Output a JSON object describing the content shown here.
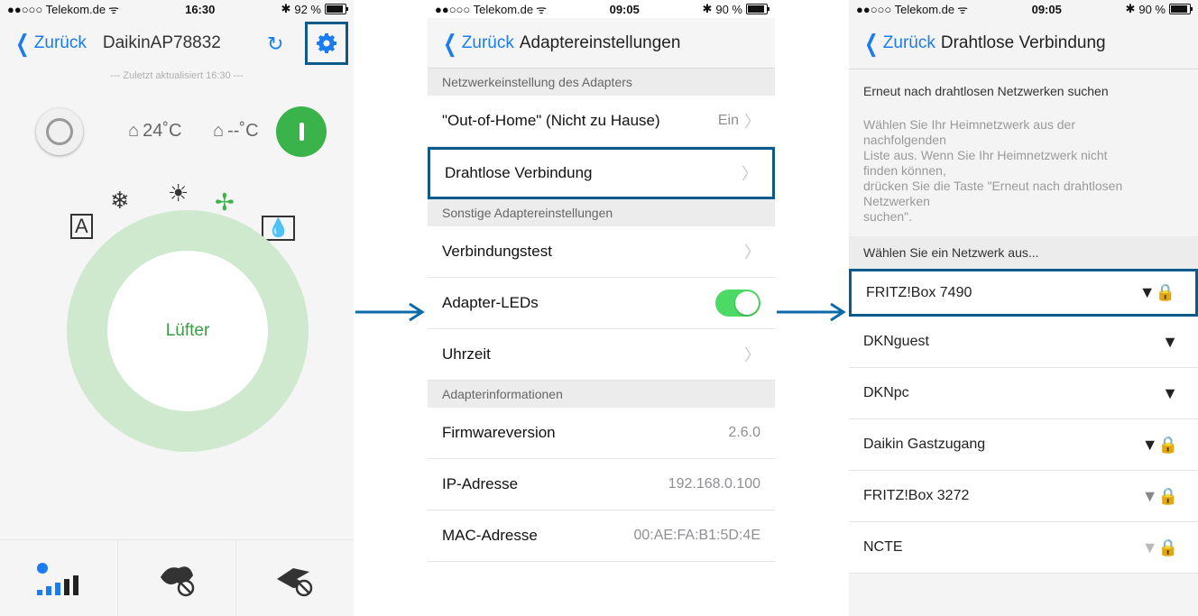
{
  "phone1": {
    "status": {
      "carrier": "●●○○○ Telekom.de",
      "time": "16:30",
      "battery": "92 %"
    },
    "nav": {
      "back": "Zurück",
      "title": "DaikinAP78832"
    },
    "updated": "--- Zuletzt aktualisiert 16:30 ---",
    "temp_indoor": "24˚C",
    "temp_outdoor": "--˚C",
    "mode_label": "Lüfter"
  },
  "phone2": {
    "status": {
      "carrier": "●●○○○ Telekom.de",
      "time": "09:05",
      "battery": "90 %"
    },
    "nav": {
      "back": "Zurück",
      "title": "Adaptereinstellungen"
    },
    "section1": "Netzwerkeinstellung des Adapters",
    "rows1": [
      {
        "label": "\"Out-of-Home\" (Nicht zu Hause)",
        "value": "Ein"
      },
      {
        "label": "Drahtlose Verbindung",
        "value": ""
      }
    ],
    "section2": "Sonstige Adaptereinstellungen",
    "rows2": [
      {
        "label": "Verbindungstest"
      },
      {
        "label": "Adapter-LEDs"
      },
      {
        "label": "Uhrzeit"
      }
    ],
    "section3": "Adapterinformationen",
    "info": [
      {
        "label": "Firmwareversion",
        "value": "2.6.0"
      },
      {
        "label": "IP-Adresse",
        "value": "192.168.0.100"
      },
      {
        "label": "MAC-Adresse",
        "value": "00:AE:FA:B1:5D:4E"
      }
    ],
    "leds_on": true
  },
  "phone3": {
    "status": {
      "carrier": "●●○○○ Telekom.de",
      "time": "09:05",
      "battery": "90 %"
    },
    "nav": {
      "back": "Zurück",
      "title": "Drahtlose Verbindung"
    },
    "rescan": "Erneut nach drahtlosen Netzwerken suchen",
    "instructions": "Wählen Sie Ihr Heimnetzwerk aus der\nnachfolgenden\nListe aus. Wenn Sie Ihr Heimnetzwerk nicht\nfinden können,\ndrücken Sie die Taste \"Erneut  nach drahtlosen\nNetzwerken\nsuchen\".",
    "choose": "Wählen Sie ein Netzwerk aus...",
    "networks": [
      {
        "name": "FRITZ!Box 7490",
        "locked": true
      },
      {
        "name": "DKNguest",
        "locked": false
      },
      {
        "name": "DKNpc",
        "locked": false
      },
      {
        "name": "Daikin Gastzugang",
        "locked": true
      },
      {
        "name": "FRITZ!Box 3272",
        "locked": true
      },
      {
        "name": "NCTE",
        "locked": true
      }
    ]
  }
}
